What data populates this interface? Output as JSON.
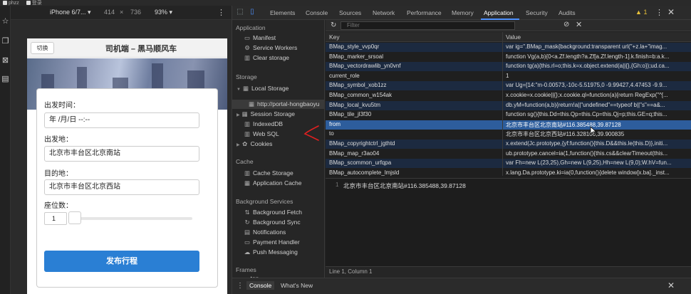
{
  "bookmarks": [
    {
      "label": "phzz"
    },
    {
      "label": "登录"
    }
  ],
  "device_toolbar": {
    "device": "iPhone 6/7... ▾",
    "width": "414",
    "times": "×",
    "height": "736",
    "zoom": "93% ▾",
    "more": "⋮"
  },
  "phone": {
    "switch_label": "切换",
    "title": "司机端 – 黑马顺风车",
    "depart_time_label": "出发时间：",
    "depart_time_value": "年 /月/日 --:--",
    "from_label": "出发地：",
    "from_value": "北京市丰台区北京南站",
    "to_label": "目的地：",
    "to_value": "北京市丰台区北京西站",
    "seats_label": "座位数：",
    "seats_value": "1",
    "submit_label": "发布行程",
    "slider_fraction": 0.0
  },
  "devtools": {
    "tabs": [
      "Elements",
      "Console",
      "Sources",
      "Network",
      "Performance",
      "Memory",
      "Application",
      "Security",
      "Audits"
    ],
    "active_tab": "Application",
    "warning_count": "1",
    "more": "⋮",
    "close": "✕"
  },
  "sidebar": {
    "application_head": "Application",
    "application_items": [
      "Manifest",
      "Service Workers",
      "Clear storage"
    ],
    "storage_head": "Storage",
    "local_storage": "Local Storage",
    "local_storage_origin": "http://portal-hongbaoyu",
    "session_storage": "Session Storage",
    "indexeddb": "IndexedDB",
    "websql": "Web SQL",
    "cookies": "Cookies",
    "cache_head": "Cache",
    "cache_items": [
      "Cache Storage",
      "Application Cache"
    ],
    "bg_head": "Background Services",
    "bg_items": [
      "Background Fetch",
      "Background Sync",
      "Notifications",
      "Payment Handler",
      "Push Messaging"
    ],
    "frames_head": "Frames",
    "frames_top": "top"
  },
  "storage": {
    "filter_placeholder": "Filter",
    "col_key": "Key",
    "col_value": "Value",
    "rows": [
      {
        "key": "BMap_style_vvp0qr",
        "value": "var ig=\".BMap_mask{background:transparent url(\"+z.la+\"imag..."
      },
      {
        "key": "BMap_marker_srsoal",
        "value": "function Vg(a,b){0<a.Zf.length?a.Zf[a.Zf.length-1].k.finish=b:a.k..."
      },
      {
        "key": "BMap_vectordrawlib_yn0vnf",
        "value": "function tg(a){this.rl=o;this.k=x.object.extend(a||{},{Gh:o});ud.ca..."
      },
      {
        "key": "current_role",
        "value": "1"
      },
      {
        "key": "BMap_symbol_xob1zz",
        "value": "var Ug=[14:\"m-0.00573,-10c-5.51975,0 -9.99427,4.47453 -9.9..."
      },
      {
        "key": "BMap_common_w154ak",
        "value": "x.cookie=x.cookie||{};x.cookie.ql=function(a){return RegExp(\"^[..."
      },
      {
        "key": "BMap_local_kvu5tm",
        "value": "db.yM=function(a,b){return!a||\"undefined\"==typeof b||\"s\"==a&..."
      },
      {
        "key": "BMap_tile_jl3f30",
        "value": "function sg(){this.Dd=this.Qp=this.Cp=this.Qj=p;this.GE=q;this..."
      },
      {
        "key": "from",
        "value": "北京市丰台区北京南站#116.385488,39.87128"
      },
      {
        "key": "to",
        "value": "北京市丰台区北京西站#116.328106,39.900835"
      },
      {
        "key": "BMap_copyrightctrl_jgthtd",
        "value": "x.extend(Jc.prototype,{yf:function(){this.D&&this.le(this.D)},initi..."
      },
      {
        "key": "BMap_map_r3ao04",
        "value": "ub.prototype.cancel=ia(1,function(){this.cs&&clearTimeout(this..."
      },
      {
        "key": "BMap_scommon_urfqpa",
        "value": "var Fh=new L(23,25),Gh=new L(9,25),Hh=new L(9,0);W.hV=fun..."
      },
      {
        "key": "BMap_autocomplete_lmjsld",
        "value": "x.lang.Da.prototype.ki=ia(0,function(){delete window[x.ba]._inst..."
      }
    ],
    "selected_index": 8,
    "preview_line_no": "1",
    "preview_text": "北京市丰台区北京南站#116.385488,39.87128",
    "status": "Line 1, Column 1"
  },
  "drawer": {
    "tabs": [
      "Console",
      "What's New"
    ],
    "active": "Console",
    "close": "✕",
    "dots": "⋮"
  },
  "colors": {
    "accent": "#4d90fe",
    "selected_row": "#2d5d9c",
    "submit_button": "#2a7fd4",
    "annotation": "#e02020"
  }
}
